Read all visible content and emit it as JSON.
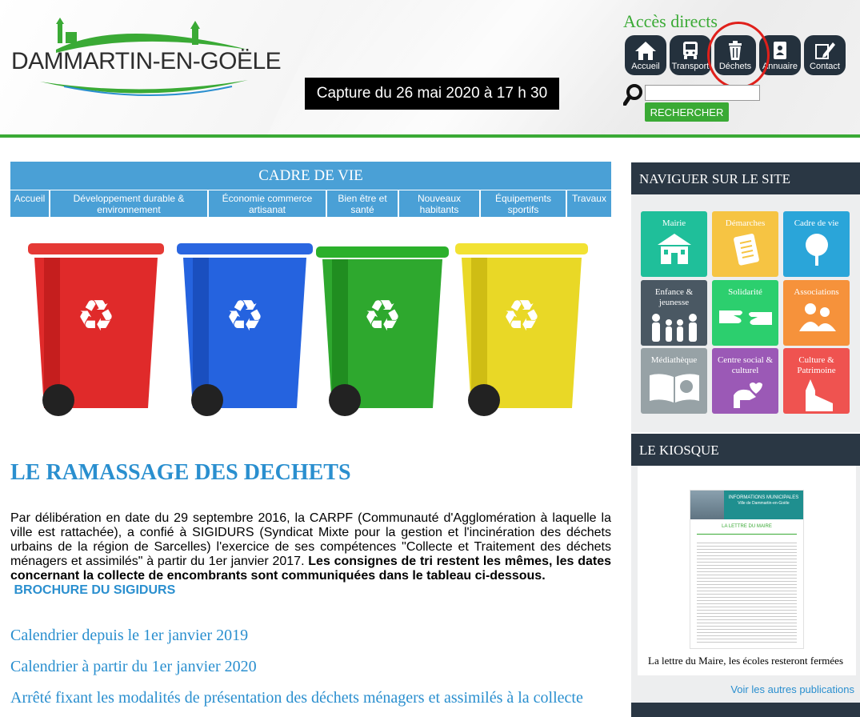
{
  "header": {
    "logo_text": "DAMMARTIN-EN-GOËLE",
    "capture_text": "Capture du 26 mai 2020 à 17 h 30",
    "acces_title": "Accès directs",
    "acces_buttons": [
      {
        "label": "Accueil",
        "icon": "home-icon"
      },
      {
        "label": "Transport",
        "icon": "bus-icon"
      },
      {
        "label": "Déchets",
        "icon": "trash-icon"
      },
      {
        "label": "Annuaire",
        "icon": "address-book-icon"
      },
      {
        "label": "Contact",
        "icon": "pencil-icon"
      }
    ],
    "search_placeholder": "",
    "search_button": "RECHERCHER",
    "colors": {
      "green": "#3aaa35",
      "dark": "#24313d",
      "highlight_circle": "#e0201b"
    }
  },
  "main": {
    "section_title": "CADRE DE VIE",
    "subnav": [
      "Accueil",
      "Développement durable & environnement",
      "Économie commerce artisanat",
      "Bien être et santé",
      "Nouveaux habitants",
      "Équipements sportifs",
      "Travaux"
    ],
    "page_title": "LE RAMASSAGE DES DECHETS",
    "paragraph_normal": "Par délibération en date du 29 septembre 2016, la CARPF (Communauté d'Agglomération à laquelle la ville est rattachée), a confié à SIGIDURS (Syndicat Mixte pour la gestion et l'incinération des déchets urbains de la région de Sarcelles) l'exercice de ses compétences \"Collecte et Traitement des déchets ménagers et assimilés\" à partir du 1er janvier 2017. ",
    "paragraph_bold": "Les consignes de tri restent les mêmes, les dates concernant la collecte de encombrants sont communiquées dans le tableau ci-dessous.",
    "brochure_link": "BROCHURE DU SIGIDURS",
    "doc_links": [
      "Calendrier depuis le 1er janvier 2019",
      "Calendrier à partir du 1er janvier 2020",
      "Arrêté fixant les modalités de présentation des déchets ménagers et assimilés à la collecte"
    ]
  },
  "sidebar": {
    "nav_title": "NAVIGUER SUR LE SITE",
    "tiles": [
      {
        "label": "Mairie",
        "color": "#1fbf9a",
        "icon": "town-hall-icon"
      },
      {
        "label": "Démarches",
        "color": "#f6c443",
        "icon": "document-icon"
      },
      {
        "label": "Cadre de vie",
        "color": "#2aa5d9",
        "icon": "tree-icon"
      },
      {
        "label": "Enfance & jeunesse",
        "color": "#4a5863",
        "icon": "family-icon"
      },
      {
        "label": "Solidarité",
        "color": "#2ccf6e",
        "icon": "hands-icon"
      },
      {
        "label": "Associations",
        "color": "#f6923b",
        "icon": "people-icon"
      },
      {
        "label": "Médiathèque",
        "color": "#97a2a6",
        "icon": "book-icon"
      },
      {
        "label": "Centre social & culturel",
        "color": "#9b59b6",
        "icon": "hand-heart-icon"
      },
      {
        "label": "Culture & Patrimoine",
        "color": "#ef5350",
        "icon": "church-icon"
      }
    ],
    "kiosk_title": "LE KIOSQUE",
    "kiosk_doc_header": "INFORMATIONS MUNICIPALES",
    "kiosk_doc_sub": "Ville de Dammartin-en-Goële",
    "kiosk_doc_title": "LA LETTRE DU MAIRE",
    "kiosk_caption": "La lettre du Maire, les écoles resteront fermées",
    "kiosk_more": "Voir les autres publications"
  }
}
